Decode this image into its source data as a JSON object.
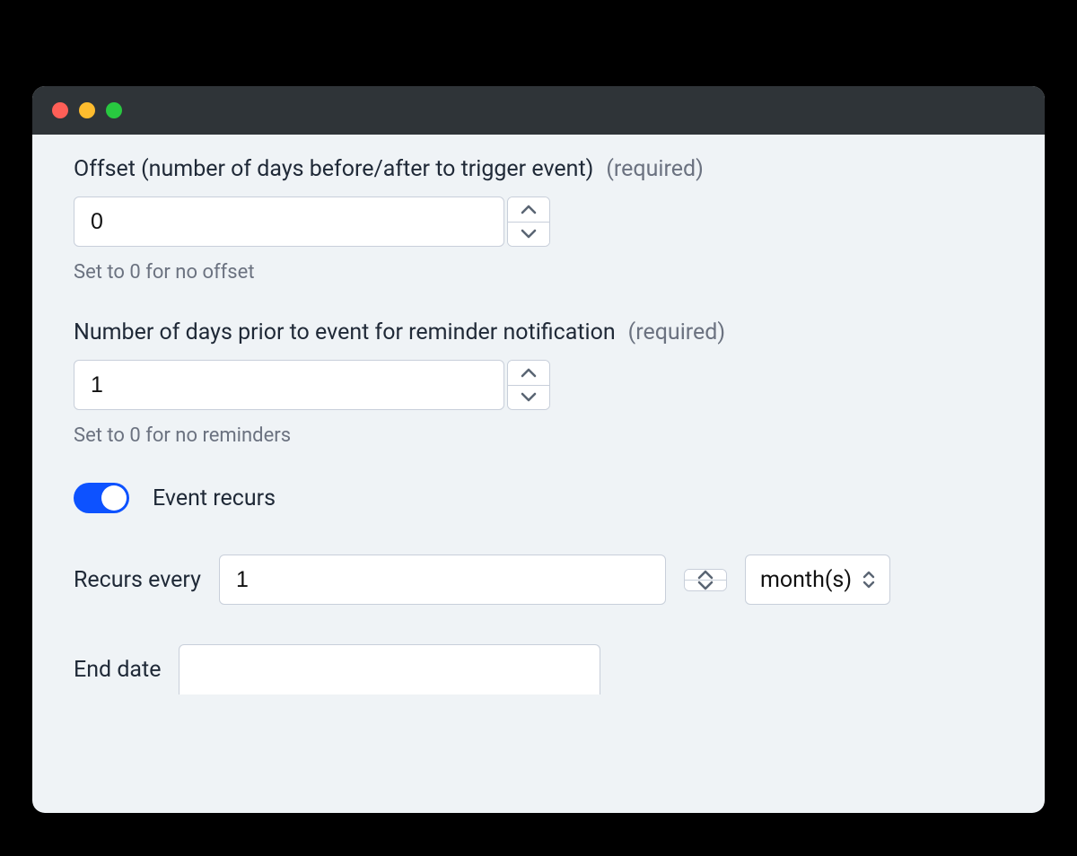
{
  "fields": {
    "offset": {
      "label": "Offset (number of days before/after to trigger event)",
      "required_text": "(required)",
      "value": "0",
      "help": "Set to 0 for no offset"
    },
    "reminder": {
      "label": "Number of days prior to event for reminder notification",
      "required_text": "(required)",
      "value": "1",
      "help": "Set to 0 for no reminders"
    },
    "recurs_toggle": {
      "label": "Event recurs",
      "enabled": true
    },
    "recurs_every": {
      "label": "Recurs every",
      "value": "1",
      "unit_selected": "month(s)"
    },
    "end_date": {
      "label": "End date",
      "value": ""
    }
  }
}
